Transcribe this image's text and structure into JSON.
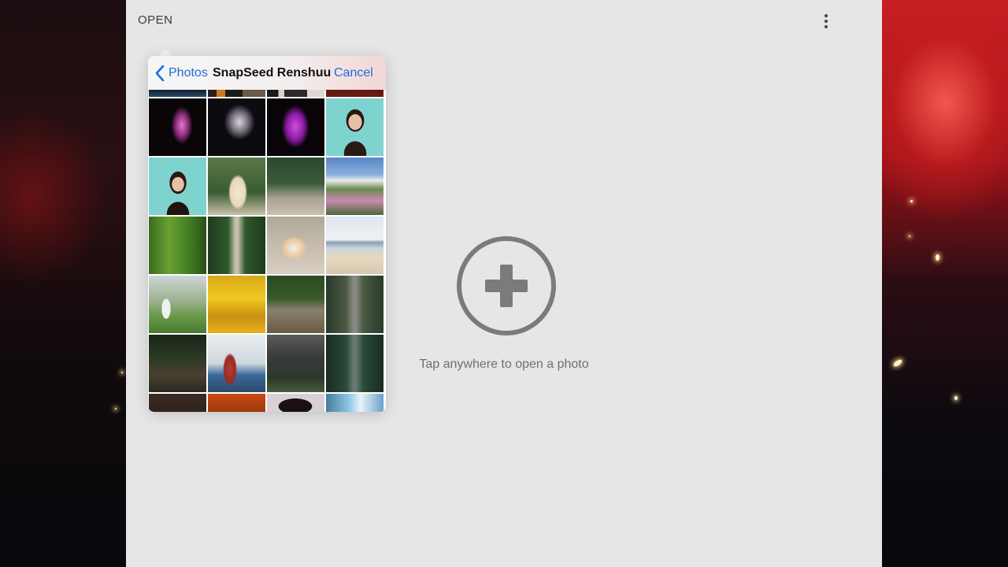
{
  "app": {
    "mode_label": "OPEN",
    "menu_icon": "more-vertical-icon",
    "empty_state": {
      "icon": "add-circle-icon",
      "message": "Tap anywhere to open a photo"
    }
  },
  "picker": {
    "back_label": "Photos",
    "back_icon": "chevron-left-icon",
    "album_title": "SnapSeed Renshuu",
    "cancel_label": "Cancel",
    "accent_color": "#1a6fd6"
  },
  "colors": {
    "app_background": "#e6e6e7",
    "icon_gray": "#7b7b7b"
  }
}
